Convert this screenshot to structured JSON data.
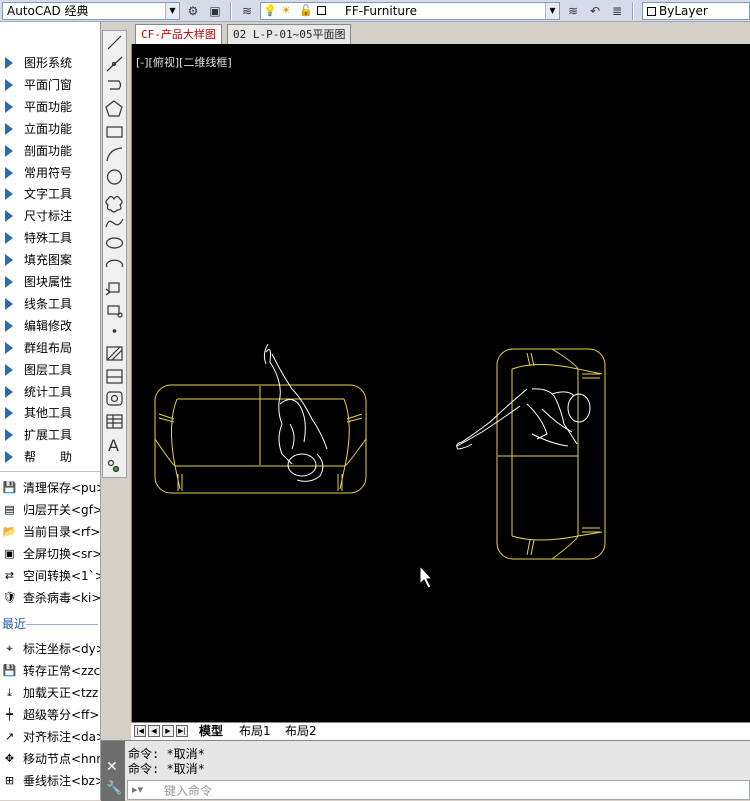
{
  "toolbar": {
    "workspace": "AutoCAD 经典",
    "layer": "FF-Furniture",
    "color": "ByLayer"
  },
  "menu": {
    "items": [
      {
        "label": "图形系统"
      },
      {
        "label": "平面门窗"
      },
      {
        "label": "平面功能"
      },
      {
        "label": "立面功能"
      },
      {
        "label": "剖面功能"
      },
      {
        "label": "常用符号"
      },
      {
        "label": "文字工具"
      },
      {
        "label": "尺寸标注"
      },
      {
        "label": "特殊工具"
      },
      {
        "label": "填充图案"
      },
      {
        "label": "图块属性"
      },
      {
        "label": "线条工具"
      },
      {
        "label": "编辑修改"
      },
      {
        "label": "群组布局"
      },
      {
        "label": "图层工具"
      },
      {
        "label": "统计工具"
      },
      {
        "label": "其他工具"
      },
      {
        "label": "扩展工具"
      },
      {
        "label": "帮　　助"
      }
    ],
    "commands": [
      {
        "label": "清理保存<pu>",
        "icon": "save-icon"
      },
      {
        "label": "归层开关<gf>",
        "icon": "layer-stack-icon"
      },
      {
        "label": "当前目录<rf>",
        "icon": "folder-dwg-icon"
      },
      {
        "label": "全屏切换<sr>",
        "icon": "fullscreen-icon"
      },
      {
        "label": "空间转换<1`>",
        "icon": "space-convert-icon"
      },
      {
        "label": "查杀病毒<ki>",
        "icon": "shield-icon"
      }
    ],
    "recent_header": "最近",
    "recent": [
      {
        "label": "标注坐标<dy>",
        "icon": "coordinate-icon"
      },
      {
        "label": "转存正常<zzc",
        "icon": "save-normal-icon"
      },
      {
        "label": "加载天正<tzz",
        "icon": "load-tz-icon"
      },
      {
        "label": "超级等分<ff>",
        "icon": "divide-icon"
      },
      {
        "label": "对齐标注<da>",
        "icon": "align-dim-icon"
      },
      {
        "label": "移动节点<hnn",
        "icon": "move-node-icon"
      },
      {
        "label": "垂线标注<bz>",
        "icon": "perp-dim-icon"
      }
    ]
  },
  "file_tabs": [
    {
      "label": "CF-产品大样图",
      "active": true
    },
    {
      "label": "02 L-P-01~05平面图",
      "active": false
    }
  ],
  "viewport_label": "[-][俯视][二维线框]",
  "layout_tabs": [
    {
      "label": "模型",
      "active": true
    },
    {
      "label": "布局1",
      "active": false
    },
    {
      "label": "布局2",
      "active": false
    }
  ],
  "command": {
    "history": [
      "命令: *取消*",
      "命令: *取消*"
    ],
    "placeholder": "键入命令"
  },
  "colors": {
    "furniture": "#e8d24a",
    "figure": "#ffffff",
    "canvas": "#000000",
    "active_tab": "#c00000"
  }
}
